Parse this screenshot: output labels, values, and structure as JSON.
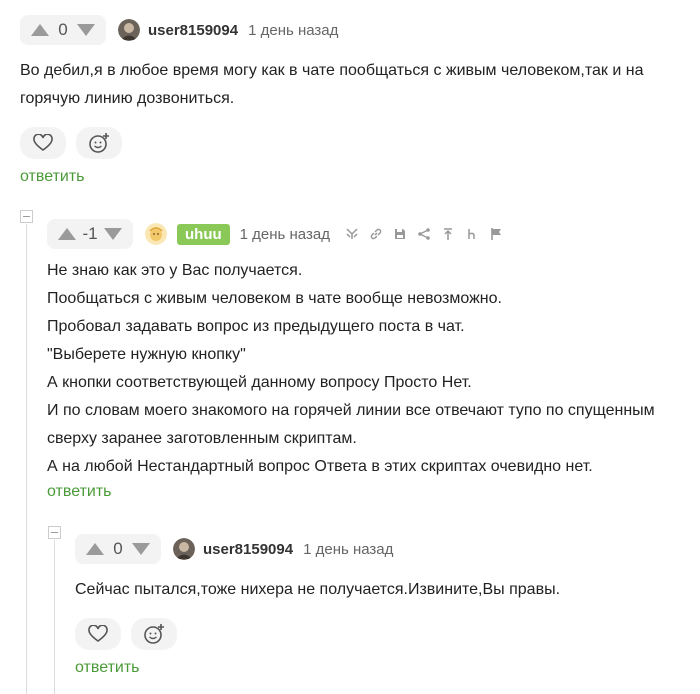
{
  "comments": [
    {
      "score": "0",
      "username": "user8159094",
      "time": "1 день назад",
      "lines": [
        "Во дебил,я в любое время могу как в чате пообщаться с живым человеком,так и на",
        "горячую линию дозвониться."
      ],
      "reply": "ответить"
    },
    {
      "score": "-1",
      "username": "uhuu",
      "time": "1 день назад",
      "lines": [
        "Не знаю как это у Вас получается.",
        "Пообщаться с живым человеком в чате вообще невозможно.",
        "Пробовал задавать вопрос из предыдущего поста в чат.",
        "\"Выберете нужную кнопку\"",
        "А кнопки соответствующей данному вопросу Просто Нет.",
        "И по словам моего знакомого на горячей линии все отвечают тупо по спущенным",
        "сверху заранее заготовленным скриптам.",
        "А на любой Нестандартный вопрос Ответа в этих скриптах очевидно нет."
      ],
      "reply": "ответить"
    },
    {
      "score": "0",
      "username": "user8159094",
      "time": "1 день назад",
      "lines": [
        "Сейчас пытался,тоже нихера не получается.Извините,Вы правы."
      ],
      "reply": "ответить"
    }
  ],
  "icons": {
    "upvote": "arrow-up-icon",
    "downvote": "arrow-down-icon",
    "like": "heart-icon",
    "emoji": "emoji-add-icon",
    "tools": [
      "branch-icon",
      "link-icon",
      "save-icon",
      "share-icon",
      "arrow-up-bar-icon",
      "hide-icon",
      "flag-icon"
    ]
  },
  "colors": {
    "reply_link": "#4b9a38",
    "username_badge_bg": "#8ac858",
    "vote_arrow": "#9a9a9a",
    "pill_bg": "#f3f3f3"
  }
}
